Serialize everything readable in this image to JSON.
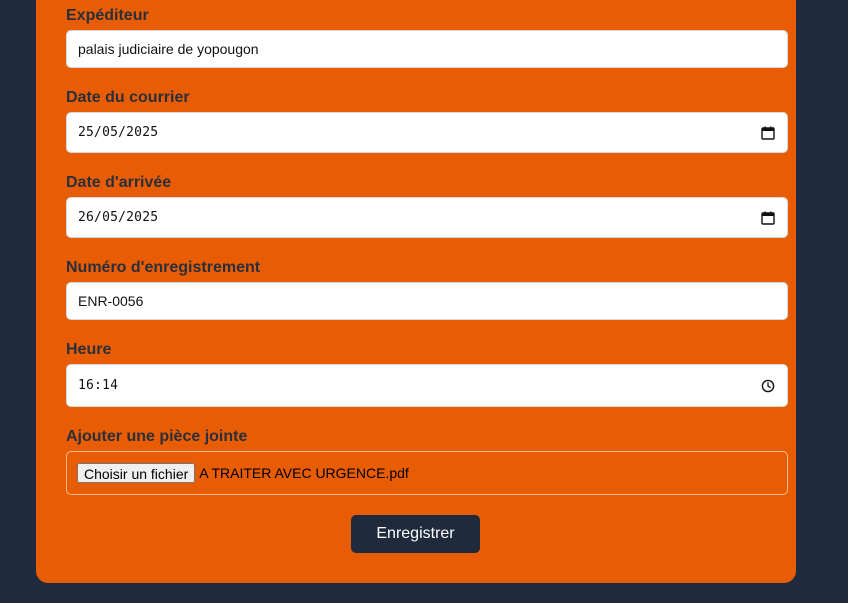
{
  "form": {
    "fields": [
      {
        "label": "Expéditeur",
        "value": "palais judiciaire de yopougon"
      },
      {
        "label": "Date du courrier",
        "value": "25/05/2025",
        "icon": "calendar-icon"
      },
      {
        "label": "Date d'arrivée",
        "value": "26/05/2025",
        "icon": "calendar-icon"
      },
      {
        "label": "Numéro d'enregistrement",
        "value": "ENR-0056"
      },
      {
        "label": "Heure",
        "value": "16:14",
        "icon": "clock-icon"
      }
    ],
    "attachment": {
      "label": "Ajouter une pièce jointe",
      "button_label": "Choisir un fichier",
      "file_name": "A TRAITER AVEC URGENCE.pdf"
    },
    "submit_label": "Enregistrer"
  },
  "colors": {
    "page_background": "#1f2a3c",
    "card_background": "#e85d04",
    "label_text": "#2a2f3a",
    "button_background": "#1f2a3c"
  }
}
